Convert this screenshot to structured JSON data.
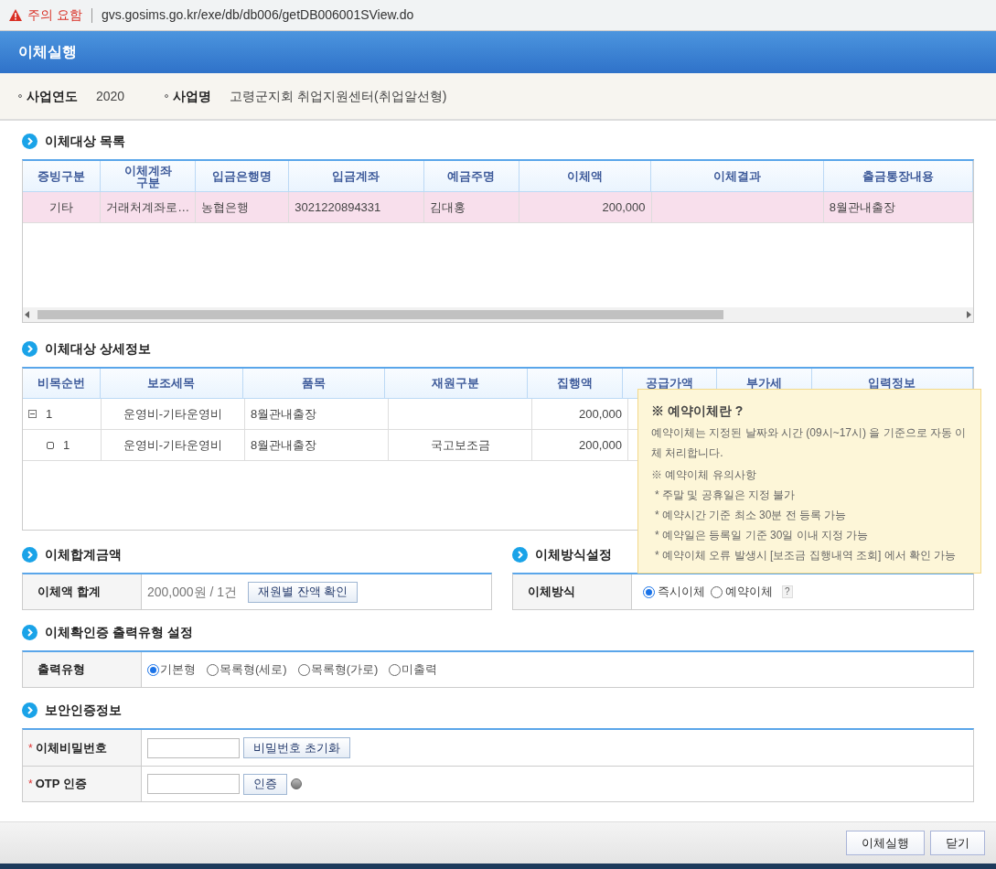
{
  "browser": {
    "warning": "주의 요함",
    "url": "gvs.gosims.go.kr/exe/db/db006/getDB006001SView.do"
  },
  "title": "이체실행",
  "info": [
    {
      "label": "사업연도",
      "value": "2020"
    },
    {
      "label": "사업명",
      "value": "고령군지회 취업지원센터(취업알선형)"
    }
  ],
  "transfer_list": {
    "heading": "이체대상 목록",
    "columns": [
      "증빙구분",
      "이체계좌\n구분",
      "입금은행명",
      "입금계좌",
      "예금주명",
      "이체액",
      "이체결과",
      "출금통장내용"
    ],
    "rows": [
      {
        "selected": true,
        "cells": [
          "기타",
          "거래처계좌로…",
          "농협은행",
          "3021220894331",
          "김대홍",
          "200,000",
          "",
          "8월관내출장"
        ]
      }
    ]
  },
  "detail": {
    "heading": "이체대상 상세정보",
    "columns": [
      "비목순번",
      "보조세목",
      "품목",
      "재원구분",
      "집행액",
      "공급가액",
      "부가세",
      "입력정보"
    ],
    "rows": [
      {
        "expanded": true,
        "cells": [
          "1",
          "운영비-기타운영비",
          "8월관내출장",
          "",
          "200,000"
        ],
        "children": [
          {
            "cells": [
              "1",
              "운영비-기타운영비",
              "8월관내출장",
              "국고보조금",
              "200,000"
            ]
          }
        ]
      }
    ]
  },
  "tooltip": {
    "title": "※ 예약이체란 ?",
    "body": "예약이체는 지정된 날짜와 시간 (09시~17시) 을 기준으로 자동 이체 처리합니다.",
    "note_title": "※ 예약이체 유의사항",
    "notes": [
      "* 주말 및 공휴일은 지정 불가",
      "* 예약시간 기준 최소 30분 전 등록 가능",
      "* 예약일은 등록일 기준 30일 이내 지정 가능",
      "* 예약이체 오류 발생시 [보조금 집행내역 조회] 에서 확인 가능"
    ]
  },
  "total": {
    "heading": "이체합계금액",
    "label": "이체액 합계",
    "value": "200,000원 / 1건",
    "button": "재원별 잔액 확인"
  },
  "method": {
    "heading": "이체방식설정",
    "label": "이체방식",
    "options": [
      {
        "label": "즉시이체",
        "selected": true
      },
      {
        "label": "예약이체",
        "selected": false
      }
    ],
    "help": "?"
  },
  "output": {
    "heading": "이체확인증 출력유형 설정",
    "label": "출력유형",
    "options": [
      {
        "label": "기본형",
        "selected": true
      },
      {
        "label": "목록형(세로)",
        "selected": false
      },
      {
        "label": "목록형(가로)",
        "selected": false
      },
      {
        "label": "미출력",
        "selected": false
      }
    ]
  },
  "security": {
    "heading": "보안인증정보",
    "rows": [
      {
        "mark": "*",
        "label": "이체비밀번호",
        "button": "비밀번호 초기화",
        "status": false
      },
      {
        "mark": "*",
        "label": "OTP 인증",
        "button": "인증",
        "status": true
      }
    ]
  },
  "footer": {
    "buttons": [
      "이체실행",
      "닫기"
    ]
  }
}
